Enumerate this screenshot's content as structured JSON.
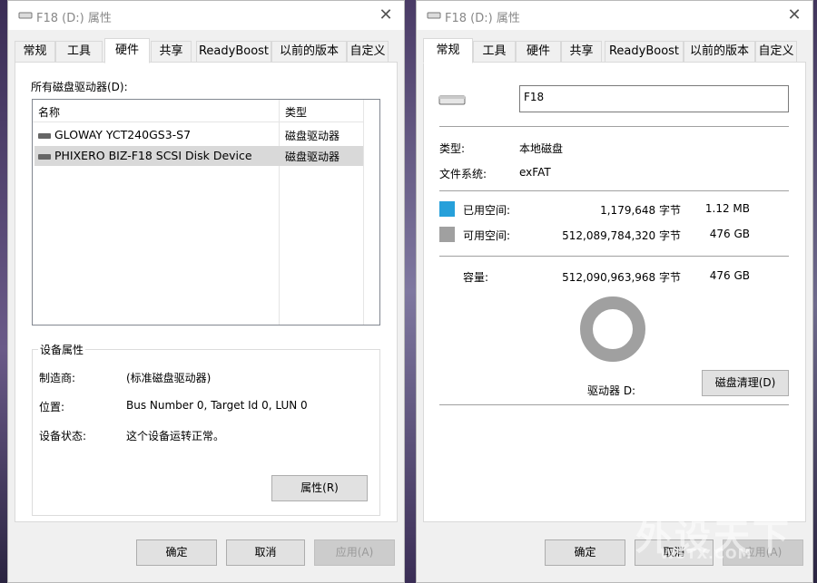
{
  "left": {
    "title": "F18 (D:) 属性",
    "tabs": [
      "常规",
      "工具",
      "硬件",
      "共享",
      "ReadyBoost",
      "以前的版本",
      "自定义"
    ],
    "active_tab": "硬件",
    "all_drives_label": "所有磁盘驱动器(D):",
    "list_headers": {
      "name": "名称",
      "type": "类型"
    },
    "rows": [
      {
        "name": "GLOWAY YCT240GS3-S7",
        "type": "磁盘驱动器"
      },
      {
        "name": "PHIXERO BIZ-F18 SCSI Disk Device",
        "type": "磁盘驱动器"
      }
    ],
    "device_props": {
      "title": "设备属性",
      "manufacturer_label": "制造商:",
      "manufacturer_value": "(标准磁盘驱动器)",
      "location_label": "位置:",
      "location_value": "Bus Number 0, Target Id 0, LUN 0",
      "status_label": "设备状态:",
      "status_value": "这个设备运转正常。",
      "properties_button": "属性(R)"
    },
    "buttons": {
      "ok": "确定",
      "cancel": "取消",
      "apply": "应用(A)"
    }
  },
  "right": {
    "title": "F18 (D:) 属性",
    "tabs": [
      "常规",
      "工具",
      "硬件",
      "共享",
      "ReadyBoost",
      "以前的版本",
      "自定义"
    ],
    "active_tab": "常规",
    "volume_name": "F18",
    "type_label": "类型:",
    "type_value": "本地磁盘",
    "fs_label": "文件系统:",
    "fs_value": "exFAT",
    "used_label": "已用空间:",
    "used_bytes": "1,179,648 字节",
    "used_size": "1.12 MB",
    "free_label": "可用空间:",
    "free_bytes": "512,089,784,320 字节",
    "free_size": "476 GB",
    "capacity_label": "容量:",
    "capacity_bytes": "512,090,963,968 字节",
    "capacity_size": "476 GB",
    "drive_label": "驱动器 D:",
    "cleanup_button": "磁盘清理(D)",
    "used_color": "#26a0da",
    "free_color": "#a0a0a0",
    "buttons": {
      "ok": "确定",
      "cancel": "取消",
      "apply": "应用(A)"
    }
  },
  "watermark": {
    "cn": "外设天下",
    "url": "WSTX.COM"
  }
}
